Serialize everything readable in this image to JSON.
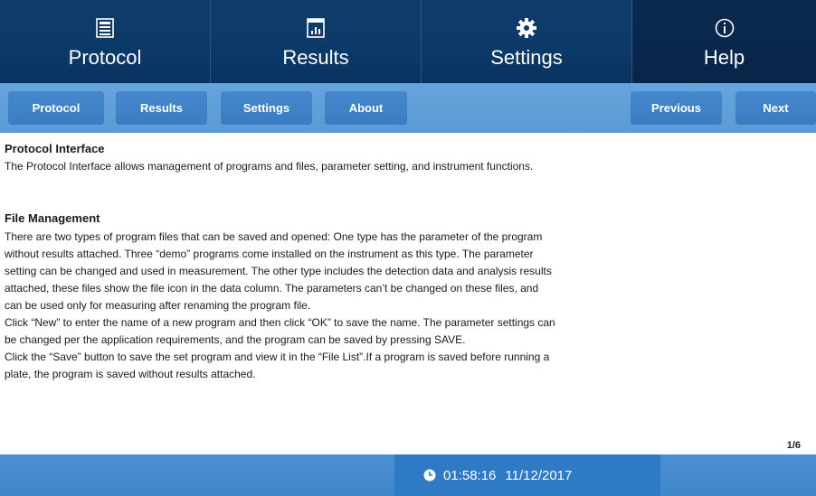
{
  "top_tabs": [
    {
      "label": "Protocol",
      "icon": "protocol-icon"
    },
    {
      "label": "Results",
      "icon": "results-chart-icon"
    },
    {
      "label": "Settings",
      "icon": "gear-icon"
    },
    {
      "label": "Help",
      "icon": "info-icon"
    }
  ],
  "active_tab": "Help",
  "sub_nav": {
    "protocol": "Protocol",
    "results": "Results",
    "settings": "Settings",
    "about": "About",
    "previous": "Previous",
    "next": "Next"
  },
  "content": {
    "section1_title": "Protocol Interface",
    "section1_text": "The Protocol Interface allows management of programs and files, parameter setting, and instrument functions.",
    "section2_title": "File Management",
    "lines": [
      "There are two types of program files that can be saved and opened: One type has the parameter of the program",
      "without results attached.  Three “demo” programs come installed on the instrument as this type.  The parameter",
      "setting can be changed and used in measurement.  The other type includes the detection data and analysis results",
      "attached, these files show the file icon in the data column.  The parameters can’t be changed on these files, and",
      "can be used only for measuring after renaming the program file.",
      "Click “New” to enter the name of a new program and then click “OK” to save the name.  The parameter settings can",
      "be changed per the application requirements, and the program can be saved by pressing SAVE.",
      "Click the “Save” button to save the set program and view it in the “File List”.If a program is saved before running a",
      "plate, the program is saved without results attached."
    ]
  },
  "page_indicator": "1/6",
  "status": {
    "time": "01:58:16",
    "date": "11/12/2017",
    "icon": "clock-icon"
  },
  "colors": {
    "top_nav": "#0c3a68",
    "sub_nav": "#5b9ad6",
    "button": "#4080c6",
    "footer": "#4389cc"
  }
}
